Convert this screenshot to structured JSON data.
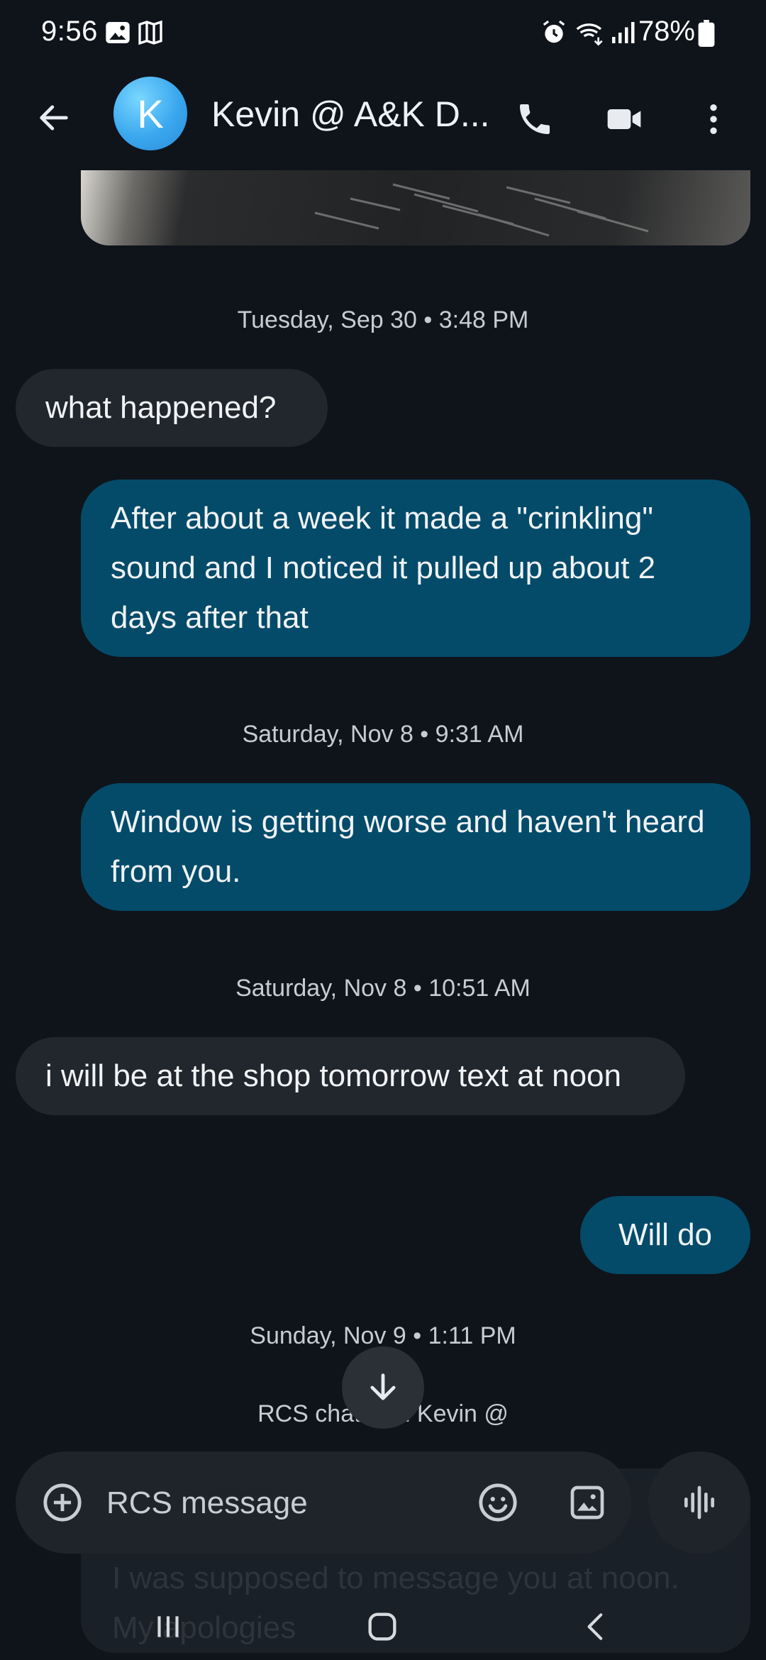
{
  "status_bar": {
    "time": "9:56",
    "battery": "78%",
    "icons": [
      "gallery-icon",
      "book-icon",
      "alarm-icon",
      "wifi-6e-icon",
      "signal-icon",
      "battery-icon"
    ]
  },
  "header": {
    "avatar_letter": "K",
    "contact_name": "Kevin @ A&K D...",
    "avatar_color": "#3aa7ee",
    "actions": [
      "phone-icon",
      "video-call-icon",
      "more-options-icon"
    ]
  },
  "colors": {
    "background": "#0f141b",
    "incoming_bubble": "#22262d",
    "outgoing_bubble": "#044b6a",
    "timestamp_text": "#c7ccd3"
  },
  "conversation": {
    "ts1": "Tuesday, Sep 30 • 3:48 PM",
    "msg1": "what happened?",
    "msg2": "After about a week it made a \"crinkling\" sound and I noticed it pulled up about 2 days after that",
    "ts2": "Saturday, Nov 8 • 9:31 AM",
    "msg3": "Window is getting worse and haven't heard from you.",
    "ts3": "Saturday, Nov 8 • 10:51 AM",
    "msg4": "i will be at the shop tomorrow text at noon",
    "msg5": "Will do",
    "ts4": "Sunday, Nov 9 • 1:11 PM",
    "rcs_note": "RCS chat with Kevin @",
    "hidden_msg": "I was supposed to message you at noon. My apologies"
  },
  "composer": {
    "placeholder": "RCS message"
  }
}
